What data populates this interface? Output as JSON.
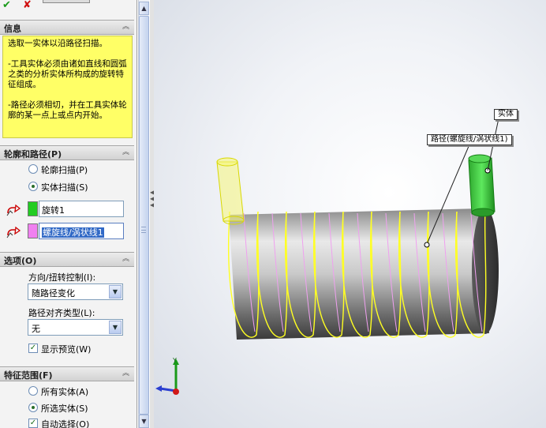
{
  "toolbar": {
    "ok_icon": "✔",
    "cancel_icon": "✘"
  },
  "message": {
    "title": "信息",
    "paragraphs": [
      "选取一实体以沿路径扫描。",
      "-工具实体必须由诸如直线和圆弧之类的分析实体所构成的旋转特征组成。",
      "-路径必须相切，并在工具实体轮廓的某一点上或点内开始。"
    ]
  },
  "profile_path": {
    "title": "轮廓和路径(P)",
    "radios": [
      {
        "label": "轮廓扫描(P)",
        "selected": false
      },
      {
        "label": "实体扫描(S)",
        "selected": true
      }
    ],
    "tool_body": {
      "value": "旋转1",
      "color": "#22cc22"
    },
    "path": {
      "value": "螺旋线/涡状线1",
      "color": "#f080f0"
    }
  },
  "options": {
    "title": "选项(O)",
    "orientation_label": "方向/扭转控制(I):",
    "orientation_value": "随路径变化",
    "alignment_label": "路径对齐类型(L):",
    "alignment_value": "无",
    "preview_label": "显示预览(W)",
    "preview_checked": true
  },
  "feature_scope": {
    "title": "特征范围(F)",
    "radios": [
      {
        "label": "所有实体(A)",
        "selected": false
      },
      {
        "label": "所选实体(S)",
        "selected": true
      }
    ],
    "auto_select_label": "自动选择(O)",
    "auto_select_checked": true
  },
  "viewport": {
    "callout_solid": "实体",
    "callout_path": "路径(螺旋线/涡状线1)"
  },
  "colors": {
    "helix": "#ffff22",
    "helix_back": "#f0a0f0",
    "tool_body_preview": "#f0f060",
    "selected_tool": "#22cc22",
    "message_bg": "#ffff66"
  },
  "icons": [
    "check-icon",
    "cross-icon",
    "collapse-icon",
    "body-select-icon",
    "path-select-icon",
    "dropdown-arrow-icon",
    "axis-triad-icon"
  ]
}
